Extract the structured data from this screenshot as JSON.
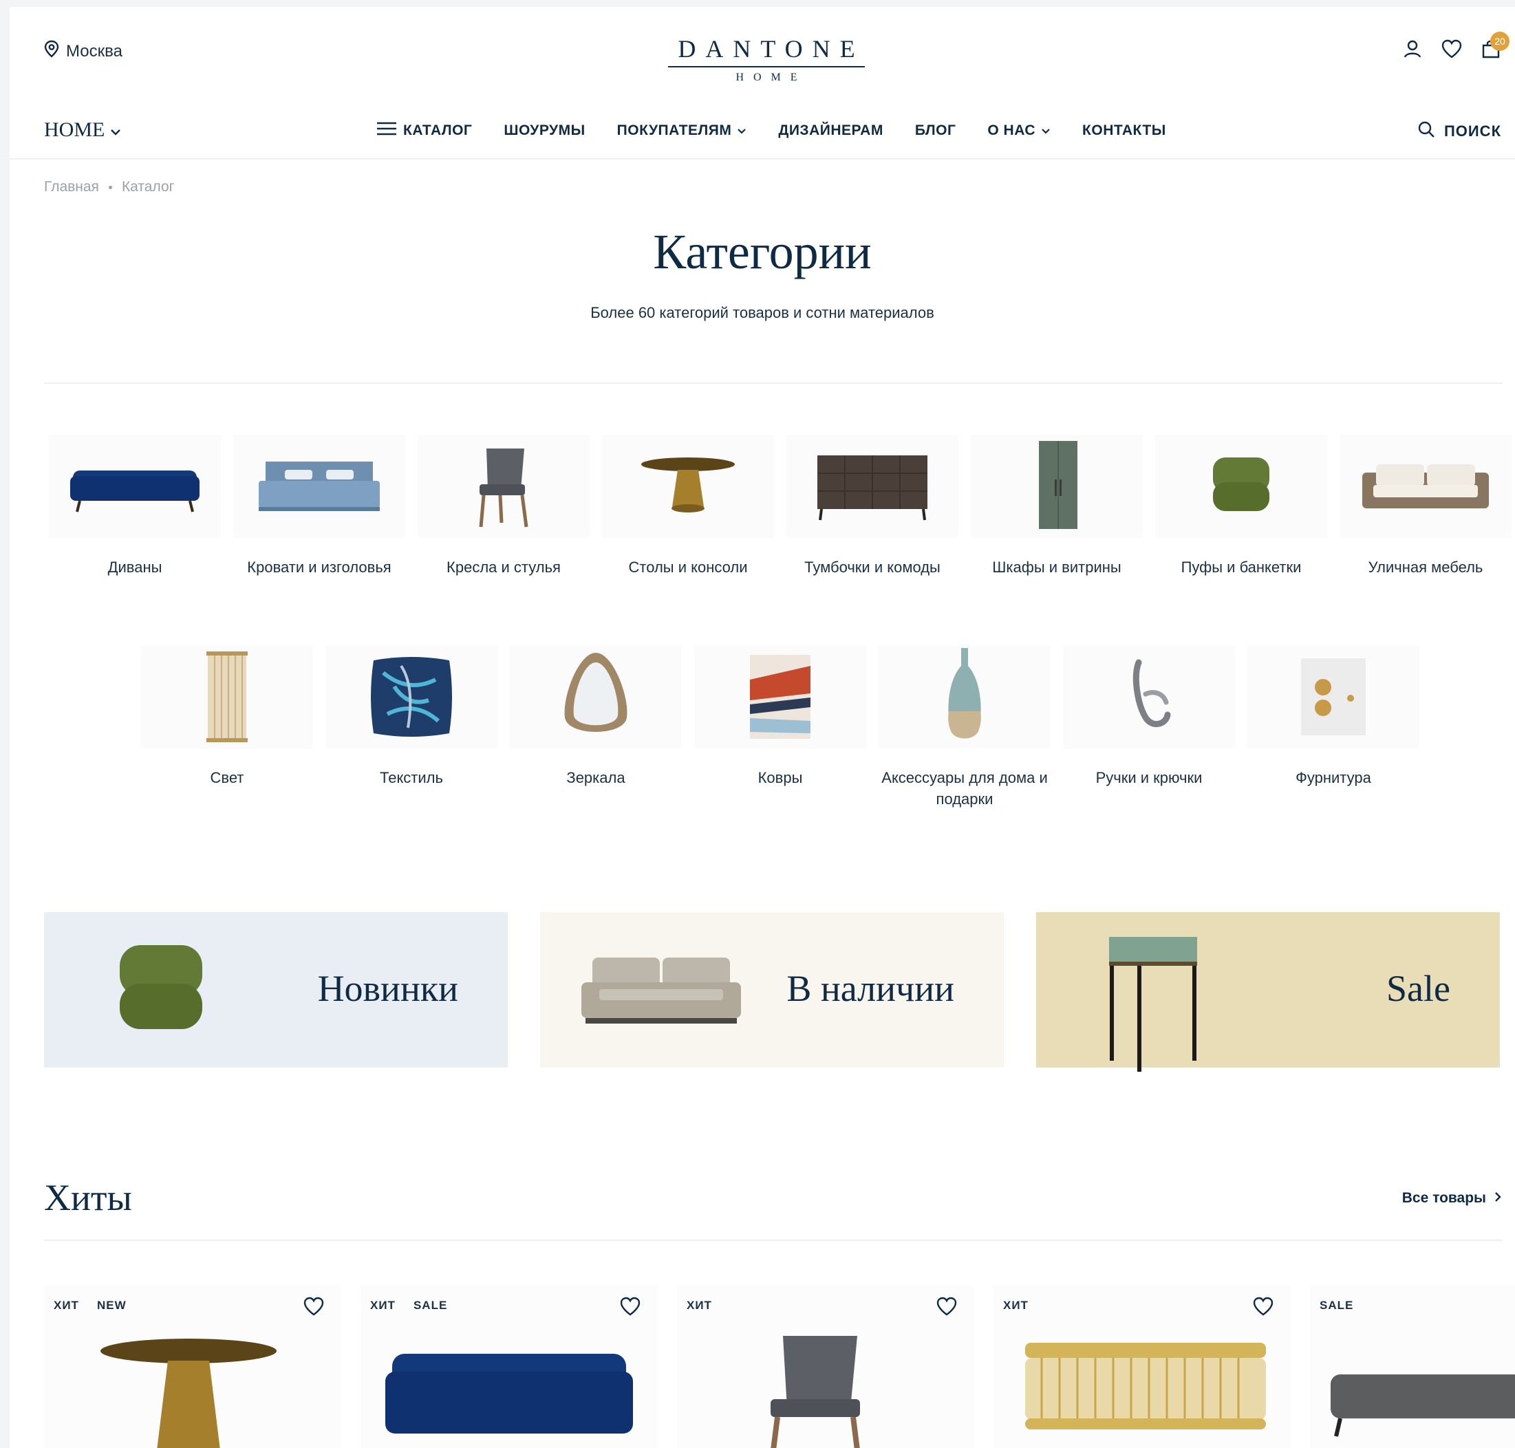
{
  "header": {
    "city": "Москва",
    "logo_main": "DANTONE",
    "logo_sub": "HOME",
    "cart_count": "20"
  },
  "nav": {
    "home_label": "HOME",
    "items": [
      "КАТАЛОГ",
      "ШОУРУМЫ",
      "ПОКУПАТЕЛЯМ",
      "ДИЗАЙНЕРАМ",
      "БЛОГ",
      "О НАС",
      "КОНТАКТЫ"
    ],
    "search_label": "ПОИСК"
  },
  "breadcrumb": [
    "Главная",
    "Каталог"
  ],
  "page": {
    "title": "Категории",
    "subtitle": "Более 60 категорий товаров и сотни материалов"
  },
  "categories_row1": [
    "Диваны",
    "Кровати и изголовья",
    "Кресла и стулья",
    "Столы и консоли",
    "Тумбочки и комоды",
    "Шкафы и витрины",
    "Пуфы и банкетки",
    "Уличная мебель"
  ],
  "categories_row2": [
    "Свет",
    "Текстиль",
    "Зеркала",
    "Ковры",
    "Аксессуары для дома и подарки",
    "Ручки и крючки",
    "Фурнитура"
  ],
  "promos": [
    "Новинки",
    "В наличии",
    "Sale"
  ],
  "colors": {
    "brand": "#0f2a44",
    "badge": "#e2a23a",
    "promo_new_bg": "#e8eef3",
    "promo_stock_bg": "#f8f6ef",
    "promo_sale_bg": "#e8ddb6"
  },
  "hits": {
    "title": "Хиты",
    "all_link": "Все товары",
    "cards": [
      {
        "badges": [
          "ХИТ",
          "NEW"
        ]
      },
      {
        "badges": [
          "ХИТ",
          "SALE"
        ]
      },
      {
        "badges": [
          "ХИТ"
        ]
      },
      {
        "badges": [
          "ХИТ"
        ]
      },
      {
        "badges": [
          "SALE"
        ]
      }
    ]
  }
}
